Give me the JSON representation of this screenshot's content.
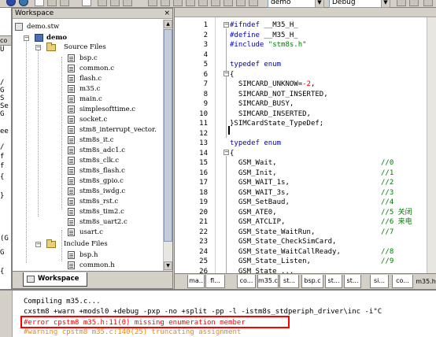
{
  "toolbar": {
    "config_combo": "demo",
    "build_combo": "Debug"
  },
  "left_strip": {
    "lines": [
      "U",
      "/",
      "G",
      "S",
      "Se",
      "G",
      "ee",
      "/",
      "f",
      "f",
      "{",
      "}",
      "(G",
      "G",
      "{"
    ],
    "tab_label": "co"
  },
  "workspace": {
    "title": "Workspace",
    "close_glyph": "×",
    "tree": {
      "workspace_file": "demo.stw",
      "project": "demo",
      "source_folder": "Source Files",
      "source_files": [
        "bsp.c",
        "common.c",
        "flash.c",
        "m35.c",
        "main.c",
        "simplesofttime.c",
        "socket.c",
        "stm8_interrupt_vector.",
        "stm8s_it.c",
        "stm8s_adc1.c",
        "stm8s_clk.c",
        "stm8s_flash.c",
        "stm8s_gpio.c",
        "stm8s_iwdg.c",
        "stm8s_rst.c",
        "stm8s_tim2.c",
        "stm8s_uart2.c",
        "usart.c"
      ],
      "include_folder": "Include Files",
      "include_files": [
        "bsp.h",
        "common.h"
      ]
    },
    "tab_label": "Workspace"
  },
  "editor": {
    "lines": [
      {
        "n": "1",
        "text": "#ifndef __M35_H_",
        "type": "pp"
      },
      {
        "n": "2",
        "text": "#define __M35_H_",
        "type": "pp"
      },
      {
        "n": "3",
        "text": "#include \"stm8s.h\"",
        "type": "inc"
      },
      {
        "n": "4",
        "text": "",
        "type": "plain"
      },
      {
        "n": "5",
        "text": "typedef enum",
        "type": "kw"
      },
      {
        "n": "6",
        "text": "{",
        "type": "plain"
      },
      {
        "n": "7",
        "text": "  SIMCARD_UNKNOW=-2,",
        "type": "neg"
      },
      {
        "n": "8",
        "text": "  SIMCARD_NOT_INSERTED,",
        "type": "plain"
      },
      {
        "n": "9",
        "text": "  SIMCARD_BUSY,",
        "type": "plain"
      },
      {
        "n": "10",
        "text": "  SIMCARD_INSERTED,",
        "type": "plain"
      },
      {
        "n": "11",
        "text": "}SIMCardState_TypeDef;",
        "type": "plain"
      },
      {
        "n": "12",
        "text": "",
        "type": "plain"
      },
      {
        "n": "13",
        "text": "typedef enum",
        "type": "kw"
      },
      {
        "n": "14",
        "text": "{",
        "type": "plain"
      },
      {
        "n": "15",
        "text": "  GSM_Wait,",
        "type": "plain",
        "comment": "//0"
      },
      {
        "n": "16",
        "text": "  GSM_Init,",
        "type": "plain",
        "comment": "//1"
      },
      {
        "n": "17",
        "text": "  GSM_WAIT_1s,",
        "type": "plain",
        "comment": "//2"
      },
      {
        "n": "18",
        "text": "  GSM_WAIT_3s,",
        "type": "plain",
        "comment": "//3"
      },
      {
        "n": "19",
        "text": "  GSM_SetBaud,",
        "type": "plain",
        "comment": "//4"
      },
      {
        "n": "20",
        "text": "  GSM_ATE0,",
        "type": "plain",
        "comment": "//5 关闭"
      },
      {
        "n": "21",
        "text": "  GSM_ATCLIP,",
        "type": "plain",
        "comment": "//6 来电"
      },
      {
        "n": "22",
        "text": "  GSM_State_WaitRun,",
        "type": "plain",
        "comment": "//7"
      },
      {
        "n": "23",
        "text": "  GSM_State_CheckSimCard,",
        "type": "plain"
      },
      {
        "n": "24",
        "text": "  GSM_State_WaitCallReady,",
        "type": "plain",
        "comment": "//8"
      },
      {
        "n": "25",
        "text": "  GSM_State_Listen,",
        "type": "plain",
        "comment": "//9"
      },
      {
        "n": "26",
        "text": "  GSM_State_...",
        "type": "plain"
      }
    ],
    "file_tabs": [
      "ma..",
      "fl...",
      "co...",
      "m35.c",
      "st...",
      "bsp.c",
      "st...",
      "st...",
      "si...",
      "co...",
      "m35.h"
    ]
  },
  "output": {
    "lines": [
      {
        "text": "Compiling m35.c...",
        "type": "normal"
      },
      {
        "text": "cxstm8 +warn +modsl0 +debug -pxp -no +split -pp -l -istm8s_stdperiph_driver\\inc -i\"C",
        "type": "normal"
      },
      {
        "text": "#error cpstm8 m35.h:11(0) missing enumeration member",
        "type": "err"
      },
      {
        "text": "#warning cpstm8 m35.c:140(25) truncating assignment",
        "type": "warn"
      }
    ]
  },
  "colors": {
    "error": "#ff0000",
    "warning": "#ff8000",
    "keyword": "#0000c0",
    "string": "#007a00",
    "number": "#d00000",
    "comment": "#007a00"
  }
}
